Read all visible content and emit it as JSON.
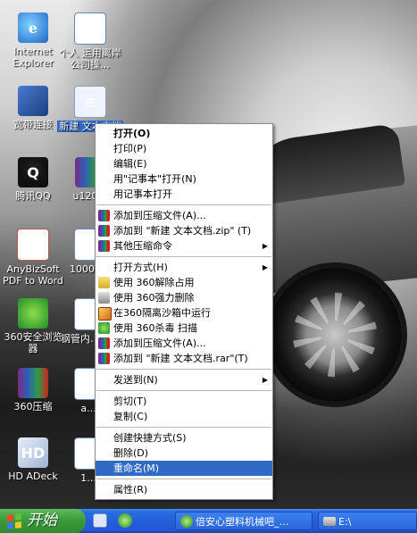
{
  "desktop_icons": [
    {
      "name": "desktop-icon-internet-explorer",
      "glyph": "e",
      "label": "Internet Explorer"
    },
    {
      "name": "desktop-icon-personal-doc",
      "glyph": "W",
      "label": "个人 运用离岸公司操…"
    },
    {
      "name": "desktop-icon-broadband",
      "glyph": "",
      "label": "宽带连接"
    },
    {
      "name": "desktop-icon-new-text-doc",
      "glyph": "≡",
      "label": "新建 文本文档"
    },
    {
      "name": "desktop-icon-tencent-qq",
      "glyph": "Q",
      "label": "腾讯QQ"
    },
    {
      "name": "desktop-icon-u120",
      "glyph": "",
      "label": "u120…"
    },
    {
      "name": "desktop-icon-anybizsoft",
      "glyph": "PDF",
      "label": "AnyBizSoft PDF to Word"
    },
    {
      "name": "desktop-icon-10001",
      "glyph": "",
      "label": "10001…"
    },
    {
      "name": "desktop-icon-360-browser",
      "glyph": "",
      "label": "360安全浏览器"
    },
    {
      "name": "desktop-icon-steel-doc",
      "glyph": "W",
      "label": "钢管内…铁…"
    },
    {
      "name": "desktop-icon-360-zip",
      "glyph": "",
      "label": "360压缩"
    },
    {
      "name": "desktop-icon-a",
      "glyph": "",
      "label": "a.…"
    },
    {
      "name": "desktop-icon-hd-adeck",
      "glyph": "HD",
      "label": "HD ADeck"
    },
    {
      "name": "desktop-icon-1",
      "glyph": "",
      "label": "1.…"
    }
  ],
  "context_menu": {
    "items": [
      {
        "label": "打开(O)",
        "bold": true
      },
      {
        "label": "打印(P)"
      },
      {
        "label": "编辑(E)"
      },
      {
        "label": "用\"记事本\"打开(N)"
      },
      {
        "label": "用记事本打开"
      },
      {
        "sep": true
      },
      {
        "label": "添加到压缩文件(A)...",
        "icon": "rar"
      },
      {
        "label": "添加到 \"新建 文本文档.zip\" (T)",
        "icon": "rar"
      },
      {
        "label": "其他压缩命令",
        "icon": "rar",
        "submenu": true
      },
      {
        "sep": true
      },
      {
        "label": "打开方式(H)",
        "submenu": true
      },
      {
        "label": "使用 360解除占用",
        "icon": "folder"
      },
      {
        "label": "使用 360强力删除",
        "icon": "shred"
      },
      {
        "label": "在360隔离沙箱中运行",
        "icon": "sandbox"
      },
      {
        "label": "使用 360杀毒 扫描",
        "icon": "shield"
      },
      {
        "label": "添加到压缩文件(A)...",
        "icon": "rar"
      },
      {
        "label": "添加到 \"新建 文本文档.rar\"(T)",
        "icon": "rar"
      },
      {
        "sep": true
      },
      {
        "label": "发送到(N)",
        "submenu": true
      },
      {
        "sep": true
      },
      {
        "label": "剪切(T)"
      },
      {
        "label": "复制(C)"
      },
      {
        "sep": true
      },
      {
        "label": "创建快捷方式(S)"
      },
      {
        "label": "删除(D)"
      },
      {
        "label": "重命名(M)",
        "highlighted": true
      },
      {
        "sep": true
      },
      {
        "label": "属性(R)"
      }
    ]
  },
  "taskbar": {
    "start_label": "开始",
    "tasks": {
      "browser": "倍安心塑料机械吧_…",
      "explorer": "E:\\"
    }
  }
}
